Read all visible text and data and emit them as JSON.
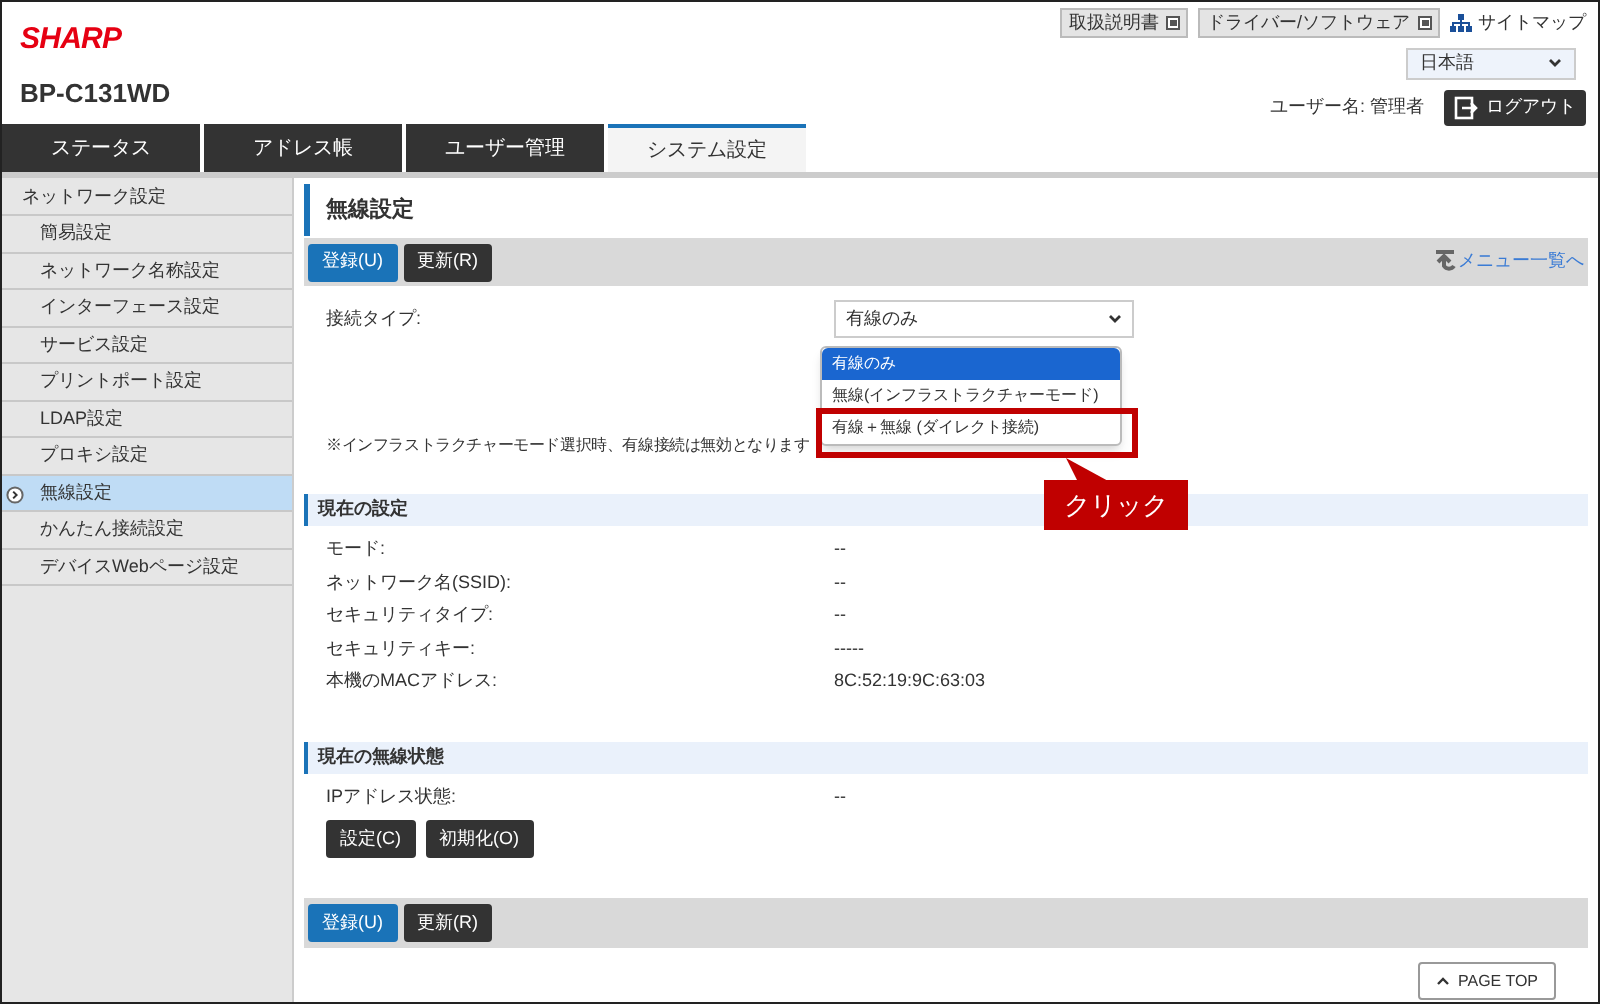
{
  "header": {
    "logo": "SHARP",
    "model": "BP-C131WD",
    "links": [
      {
        "label": "取扱説明書",
        "kind": "external"
      },
      {
        "label": "ドライバー/ソフトウェア",
        "kind": "external"
      },
      {
        "label": "サイトマップ",
        "kind": "sitemap"
      }
    ],
    "language": "日本語",
    "user_label": "ユーザー名:",
    "user_name": "管理者",
    "logout": "ログアウト"
  },
  "tabs": [
    {
      "label": "ステータス",
      "selected": false
    },
    {
      "label": "アドレス帳",
      "selected": false
    },
    {
      "label": "ユーザー管理",
      "selected": false
    },
    {
      "label": "システム設定",
      "selected": true
    }
  ],
  "sidebar": {
    "heading": "ネットワーク設定",
    "items": [
      {
        "label": "簡易設定",
        "selected": false
      },
      {
        "label": "ネットワーク名称設定",
        "selected": false
      },
      {
        "label": "インターフェース設定",
        "selected": false
      },
      {
        "label": "サービス設定",
        "selected": false
      },
      {
        "label": "プリントポート設定",
        "selected": false
      },
      {
        "label": "LDAP設定",
        "selected": false
      },
      {
        "label": "プロキシ設定",
        "selected": false
      },
      {
        "label": "無線設定",
        "selected": true
      },
      {
        "label": "かんたん接続設定",
        "selected": false
      },
      {
        "label": "デバイスWebページ設定",
        "selected": false
      }
    ]
  },
  "page_title": "無線設定",
  "top_buttons": [
    {
      "label": "登録(U)",
      "kind": "primary"
    },
    {
      "label": "更新(R)",
      "kind": "secondary"
    }
  ],
  "menu_link": "メニュー一覧へ",
  "connection": {
    "label": "接続タイプ:",
    "value": "有線のみ",
    "options": [
      {
        "label": "有線のみ",
        "selected": true,
        "highlighted": false
      },
      {
        "label": "無線(インフラストラクチャーモード)",
        "selected": false,
        "highlighted": false
      },
      {
        "label": "有線＋無線 (ダイレクト接続)",
        "selected": false,
        "highlighted": true
      }
    ],
    "note": "※インフラストラクチャーモード選択時、有線接続は無効となります"
  },
  "callout": "クリック",
  "current_settings": {
    "title": "現在の設定",
    "rows": [
      {
        "label": "モード:",
        "value": "--"
      },
      {
        "label": "ネットワーク名(SSID):",
        "value": "--"
      },
      {
        "label": "セキュリティタイプ:",
        "value": "--"
      },
      {
        "label": "セキュリティキー:",
        "value": "-----"
      },
      {
        "label": "本機のMACアドレス:",
        "value": "8C:52:19:9C:63:03"
      }
    ]
  },
  "wireless_status": {
    "title": "現在の無線状態",
    "rows": [
      {
        "label": "IPアドレス状態:",
        "value": "--"
      }
    ],
    "buttons": [
      {
        "label": "設定(C)",
        "kind": "secondary"
      },
      {
        "label": "初期化(O)",
        "kind": "secondary"
      }
    ]
  },
  "bottom_buttons": [
    {
      "label": "登録(U)",
      "kind": "primary"
    },
    {
      "label": "更新(R)",
      "kind": "secondary"
    }
  ],
  "page_top": "PAGE TOP"
}
